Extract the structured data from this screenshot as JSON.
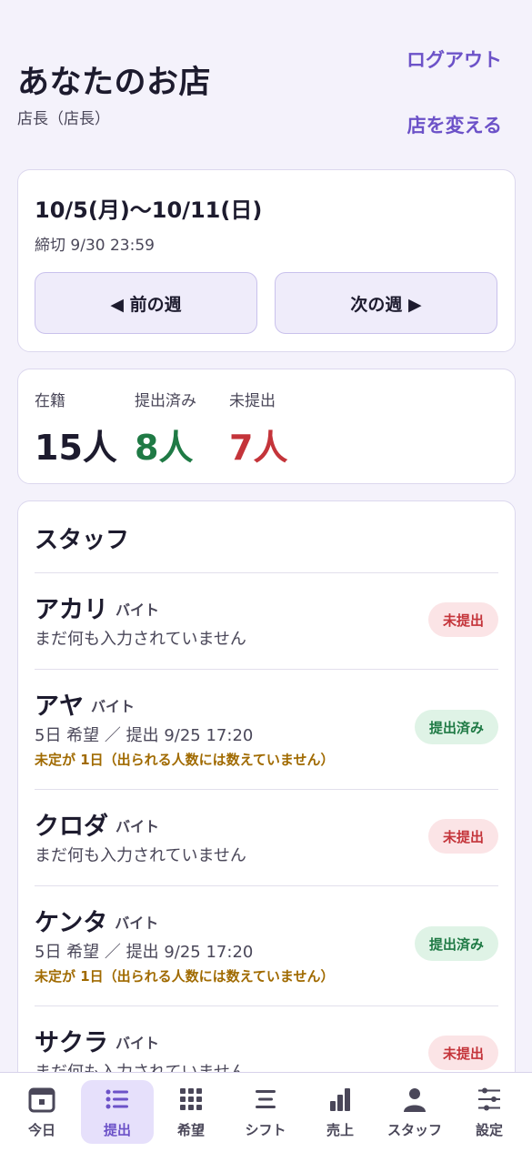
{
  "header": {
    "store_name": "あなたのお店",
    "role": "店長（店長）",
    "logout": "ログアウト",
    "change_store": "店を変える"
  },
  "week": {
    "range": "10/5(月)〜10/11(日)",
    "deadline": "締切 9/30 23:59",
    "prev": "◀ 前の週",
    "next": "次の週 ▶"
  },
  "stats": {
    "enrolled_label": "在籍",
    "enrolled_value": "15人",
    "submitted_label": "提出済み",
    "submitted_value": "8人",
    "unsubmitted_label": "未提出",
    "unsubmitted_value": "7人"
  },
  "staff": {
    "heading": "スタッフ",
    "items": [
      {
        "name": "アカリ",
        "type": "バイト",
        "detail": "まだ何も入力されていません",
        "warning": "",
        "status": "未提出"
      },
      {
        "name": "アヤ",
        "type": "バイト",
        "detail": "5日 希望 ／ 提出 9/25 17:20",
        "warning": "未定が 1日（出られる人数には数えていません）",
        "status": "提出済み"
      },
      {
        "name": "クロダ",
        "type": "バイト",
        "detail": "まだ何も入力されていません",
        "warning": "",
        "status": "未提出"
      },
      {
        "name": "ケンタ",
        "type": "バイト",
        "detail": "5日 希望 ／ 提出 9/25 17:20",
        "warning": "未定が 1日（出られる人数には数えていません）",
        "status": "提出済み"
      },
      {
        "name": "サクラ",
        "type": "バイト",
        "detail": "まだ何も入力されていません",
        "warning": "",
        "status": "未提出"
      }
    ]
  },
  "tabs": [
    {
      "label": "今日",
      "icon": "calendar-icon"
    },
    {
      "label": "提出",
      "icon": "list-icon"
    },
    {
      "label": "希望",
      "icon": "grid-icon"
    },
    {
      "label": "シフト",
      "icon": "lines-icon"
    },
    {
      "label": "売上",
      "icon": "bar-chart-icon"
    },
    {
      "label": "スタッフ",
      "icon": "person-icon"
    },
    {
      "label": "設定",
      "icon": "sliders-icon"
    }
  ],
  "colors": {
    "accent": "#6c52c8",
    "submitted": "#1f7a45",
    "unsubmitted": "#c4343a",
    "warning": "#a06a00"
  }
}
